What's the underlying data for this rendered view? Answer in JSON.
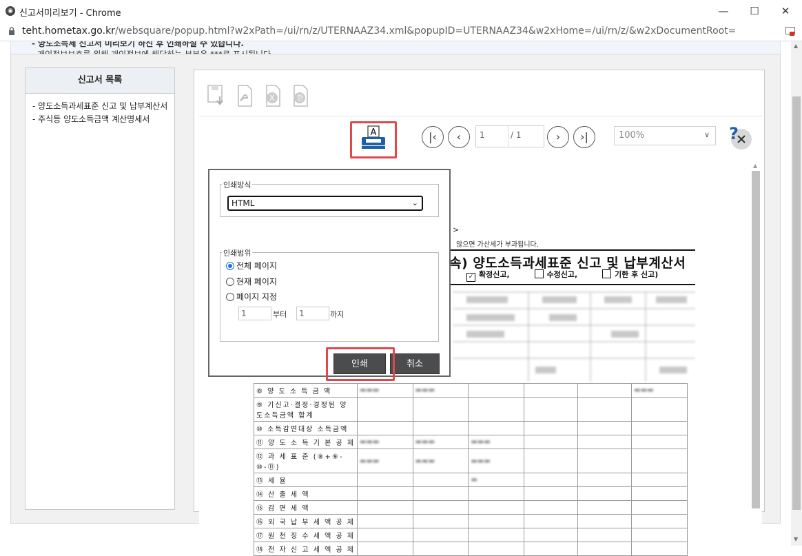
{
  "window": {
    "title": "신고서미리보기 - Chrome",
    "url_host": "teht.hometax.go.kr",
    "url_path": "/websquare/popup.html?w2xPath=/ui/rn/z/UTERNAAZ34.xml&popupID=UTERNAAZ34&w2xHome=/ui/rn/z/&w2xDocumentRoot="
  },
  "notice": {
    "line1": "- 양도소득세 신고서 미리보기 하신 후 인쇄하실 수 있습니다.",
    "line2": "- 개인정보보호를 위해 개인정보에 해당하는 부분은  ***로 표시됩니다."
  },
  "report_list": {
    "heading": "신고서 목록",
    "items": [
      "- 양도소득과세표준 신고 및 납부계산서",
      "- 주식등 양도소득금액 계산명세서"
    ]
  },
  "viewer": {
    "page_current": "1",
    "page_total": "/ 1",
    "zoom": "100%",
    "nav": {
      "first": "|‹",
      "prev": "‹",
      "next": "›",
      "last": "›|"
    }
  },
  "document": {
    "fragment1": ">",
    "fragment2": "않으면 가산세가 부과됩니다.",
    "title": "속) 양도소득과세표준 신고 및 납부계산서",
    "option1": "확정신고,",
    "option2": "수정신고,",
    "option3": "기한 후 신고)",
    "rows": [
      "⑧ 양 도 소 득 금 액",
      "⑨ 기신고·결정·경정된 양도소득금액 합계",
      "⑩ 소득감면대상 소득금액",
      "⑪ 양 도 소 득 기 본 공 제",
      "⑫ 과 세 표 준 (⑧+⑨-⑩-⑪)",
      "⑬ 세 율",
      "⑭ 산 출 세 액",
      "⑮ 감 면 세 액",
      "⑯ 외 국 납 부 세 액 공 제",
      "⑰ 원 천 징 수 세 액 공 제",
      "⑱ 전 자 신 고 세 액 공 제"
    ]
  },
  "print_dialog": {
    "method_legend": "인쇄방식",
    "method_value": "HTML",
    "range_legend": "인쇄범위",
    "range_all": "전체 페이지",
    "range_current": "현재 페이지",
    "range_custom": "페이지 지정",
    "from_value": "1",
    "from_label": "부터",
    "to_value": "1",
    "to_label": "까지",
    "print_button": "인쇄",
    "cancel_button": "취소"
  },
  "colors": {
    "highlight": "#e0484c",
    "button_dark": "#4a4c4e",
    "printer_blue": "#1f5fa8"
  }
}
